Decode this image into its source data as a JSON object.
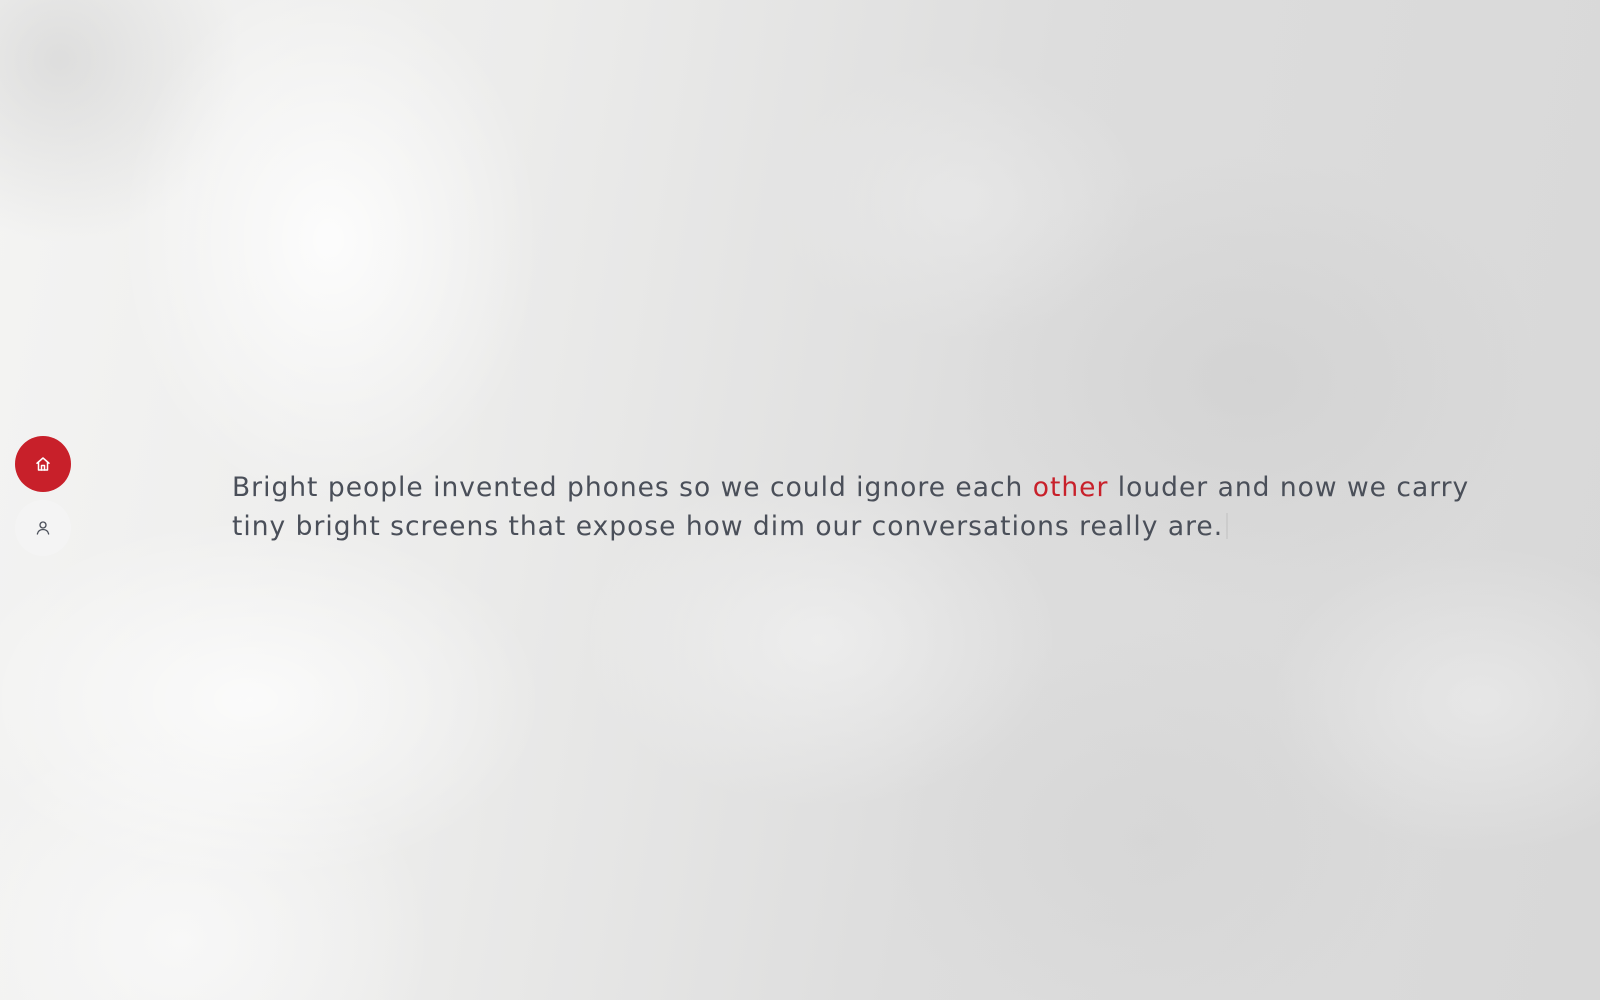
{
  "colors": {
    "accent": "#c8202a",
    "text": "#4a4f59"
  },
  "nav": {
    "home_icon": "home-icon",
    "profile_icon": "user-icon"
  },
  "quote": {
    "part1": "Bright people invented phones so we could ignore each ",
    "highlight": "other",
    "part2": " louder and now we carry tiny bright screens that expose how dim our conversations really are."
  }
}
